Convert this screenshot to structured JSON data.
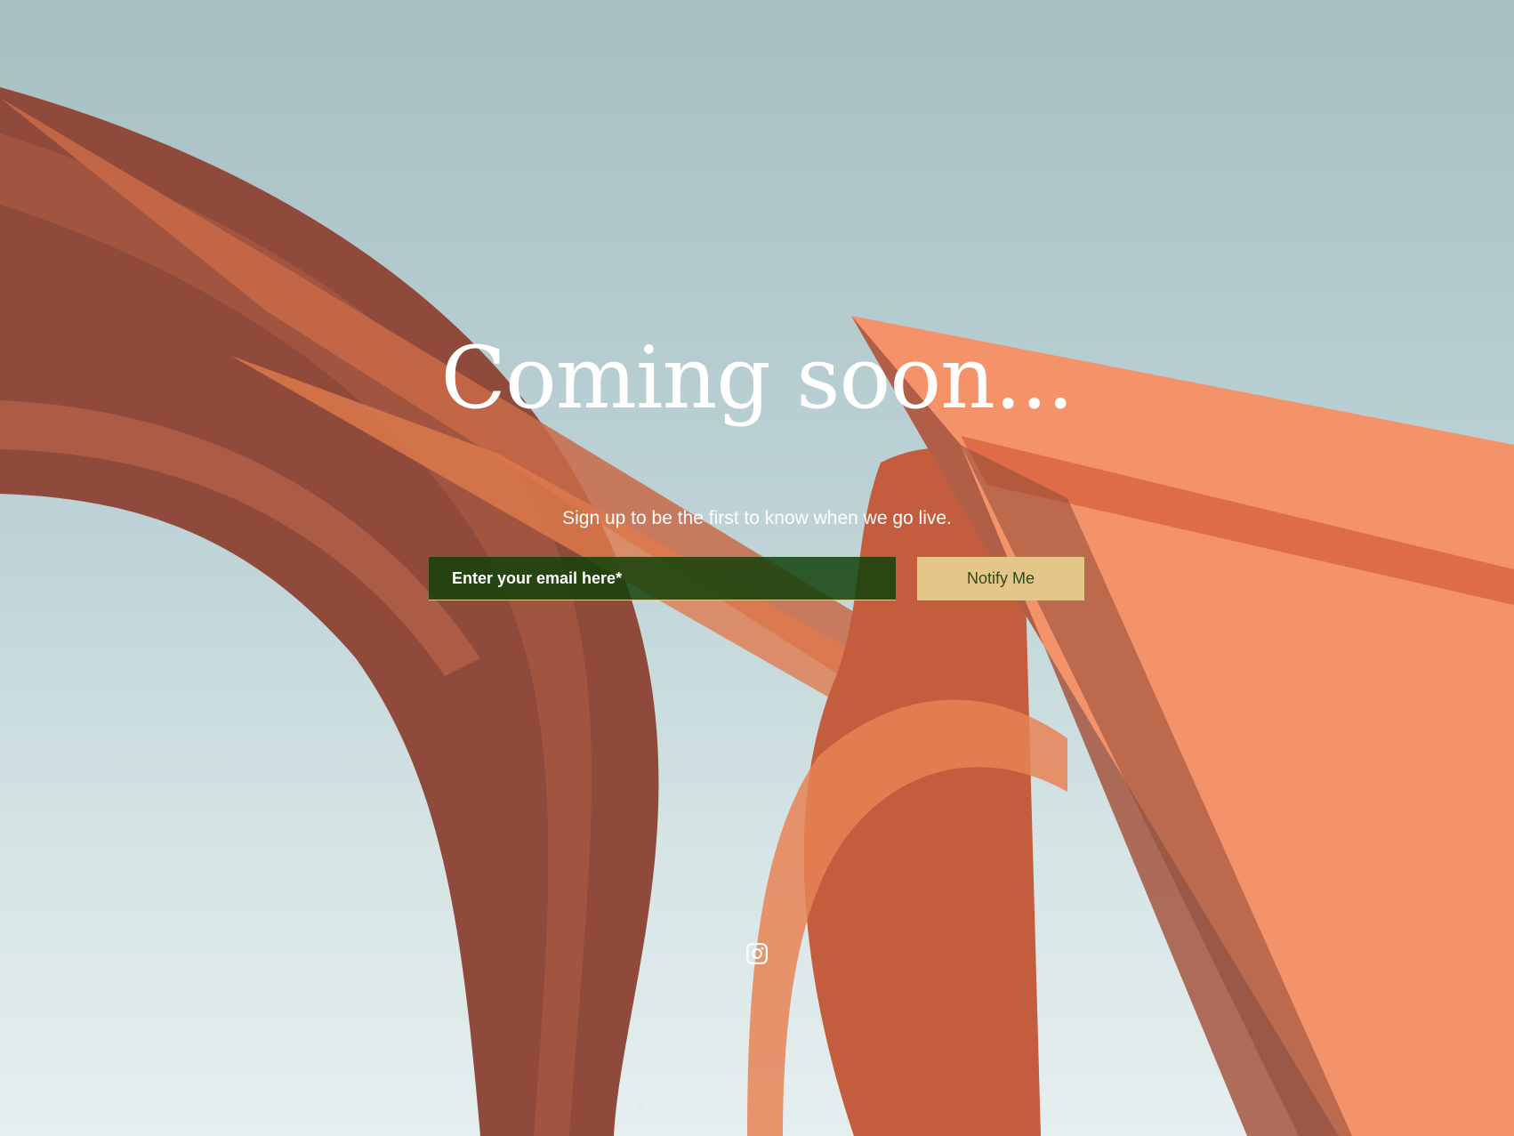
{
  "hero": {
    "title": "Coming soon...",
    "subtitle": "Sign up to be the first to know when we go live."
  },
  "form": {
    "email_placeholder": "Enter your email here*",
    "email_value": "",
    "submit_label": "Notify Me"
  },
  "social": {
    "icon": "instagram-icon"
  },
  "colors": {
    "sky_top": "#a6bfc3",
    "sky_bottom": "#e6efef",
    "sculpture_dark": "#8e4a3a",
    "sculpture_light": "#f4946a",
    "input_background": "#12420a",
    "button_background": "#e4c688",
    "button_text": "#2d4a18",
    "text": "#ffffff"
  }
}
